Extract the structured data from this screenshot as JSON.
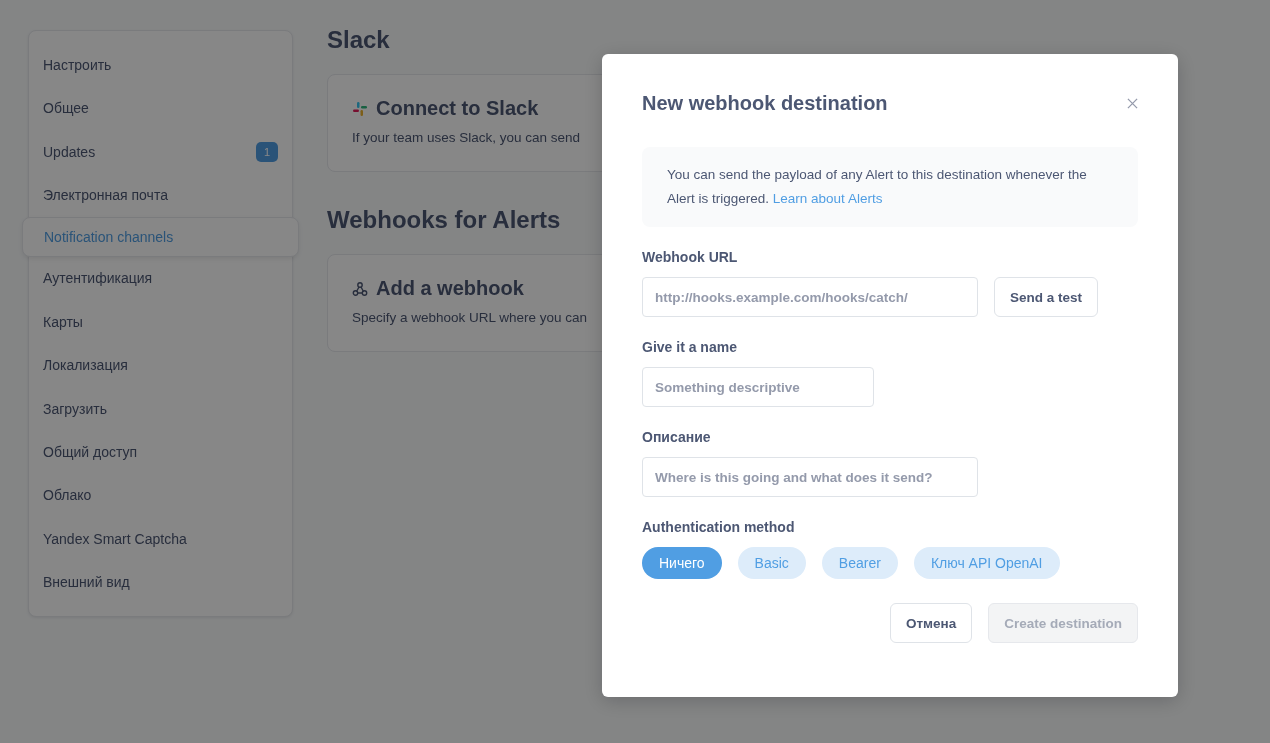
{
  "sidebar": {
    "items": [
      {
        "label": "Настроить",
        "selected": false
      },
      {
        "label": "Общее",
        "selected": false
      },
      {
        "label": "Updates",
        "selected": false,
        "badge": "1"
      },
      {
        "label": "Электронная почта",
        "selected": false
      },
      {
        "label": "Notification channels",
        "selected": true
      },
      {
        "label": "Аутентификация",
        "selected": false
      },
      {
        "label": "Карты",
        "selected": false
      },
      {
        "label": "Локализация",
        "selected": false
      },
      {
        "label": "Загрузить",
        "selected": false
      },
      {
        "label": "Общий доступ",
        "selected": false
      },
      {
        "label": "Облако",
        "selected": false
      },
      {
        "label": "Yandex Smart Captcha",
        "selected": false
      },
      {
        "label": "Внешний вид",
        "selected": false
      }
    ]
  },
  "sections": [
    {
      "heading": "Slack",
      "card": {
        "kind": "slack",
        "title": "Connect to Slack",
        "text": "If your team uses Slack, you can send"
      }
    },
    {
      "heading": "Webhooks for Alerts",
      "card": {
        "kind": "webhook",
        "title": "Add a webhook",
        "text": "Specify a webhook URL where you can"
      }
    }
  ],
  "modal": {
    "title": "New webhook destination",
    "info": "You can send the payload of any Alert to this destination whenever the Alert is triggered.",
    "info_link": "Learn about Alerts",
    "fields": [
      {
        "label": "Webhook URL",
        "placeholder": "http://hooks.example.com/hooks/catch/",
        "button": "Send a test"
      },
      {
        "label": "Give it a name",
        "placeholder": "Something descriptive"
      },
      {
        "label": "Описание",
        "placeholder": "Where is this going and what does it send?"
      }
    ],
    "auth": {
      "label": "Authentication method",
      "options": [
        {
          "label": "Ничего",
          "selected": true
        },
        {
          "label": "Basic",
          "selected": false
        },
        {
          "label": "Bearer",
          "selected": false
        },
        {
          "label": "Ключ API OpenAI",
          "selected": false
        }
      ]
    },
    "buttons": [
      {
        "label": "Отмена",
        "disabled": false
      },
      {
        "label": "Create destination",
        "disabled": true
      }
    ]
  }
}
